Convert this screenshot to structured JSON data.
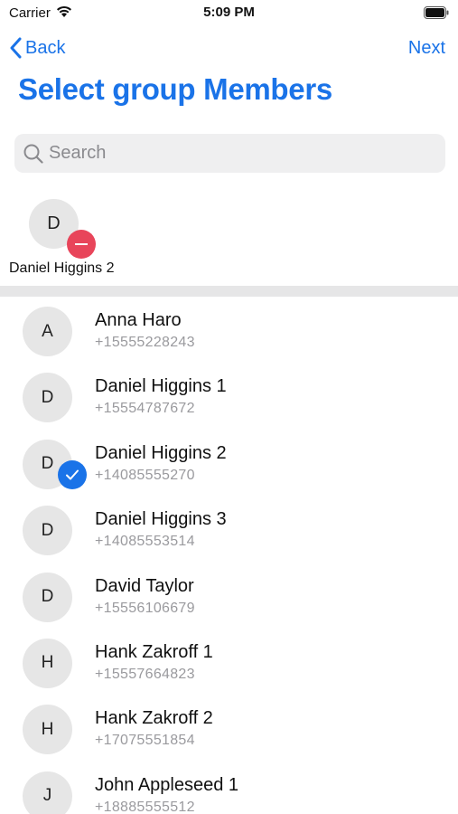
{
  "status_bar": {
    "carrier": "Carrier",
    "time": "5:09 PM"
  },
  "nav": {
    "back_label": "Back",
    "next_label": "Next"
  },
  "page_title": "Select group Members",
  "search": {
    "placeholder": "Search",
    "value": ""
  },
  "selected": [
    {
      "initial": "D",
      "name": "Daniel Higgins 2"
    }
  ],
  "contacts": [
    {
      "initial": "A",
      "name": "Anna Haro",
      "phone": "+15555228243",
      "selected": false
    },
    {
      "initial": "D",
      "name": "Daniel Higgins 1",
      "phone": "+15554787672",
      "selected": false
    },
    {
      "initial": "D",
      "name": "Daniel Higgins 2",
      "phone": "+14085555270",
      "selected": true
    },
    {
      "initial": "D",
      "name": "Daniel Higgins 3",
      "phone": "+14085553514",
      "selected": false
    },
    {
      "initial": "D",
      "name": "David Taylor",
      "phone": "+15556106679",
      "selected": false
    },
    {
      "initial": "H",
      "name": "Hank Zakroff 1",
      "phone": "+15557664823",
      "selected": false
    },
    {
      "initial": "H",
      "name": "Hank Zakroff 2",
      "phone": "+17075551854",
      "selected": false
    },
    {
      "initial": "J",
      "name": "John Appleseed 1",
      "phone": "+18885555512",
      "selected": false
    }
  ],
  "colors": {
    "accent": "#1a73e8",
    "remove": "#e8455a",
    "avatar_bg": "#e6e6e6"
  }
}
